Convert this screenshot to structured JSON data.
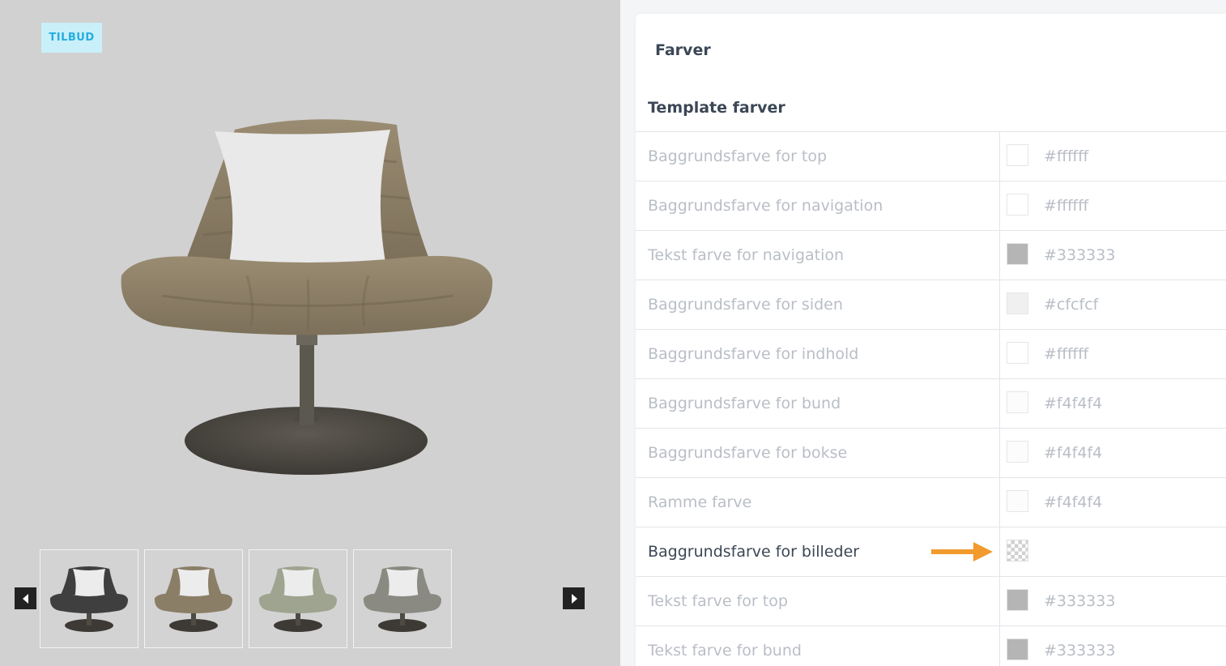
{
  "preview": {
    "badge": "TILBUD",
    "thumbnails": [
      {
        "name": "thumb-black",
        "fabric": "#3f3f3f"
      },
      {
        "name": "thumb-beige",
        "fabric": "#8b7e67"
      },
      {
        "name": "thumb-sage",
        "fabric": "#9ea48f"
      },
      {
        "name": "thumb-grey",
        "fabric": "#8a8a82"
      }
    ],
    "prev_icon": "chevron-left-icon",
    "next_icon": "chevron-right-icon"
  },
  "panel": {
    "title": "Farver",
    "section_title": "Template farver",
    "rows": [
      {
        "label": "Baggrundsfarve for top",
        "hex": "#ffffff",
        "swatch": "#ffffff"
      },
      {
        "label": "Baggrundsfarve for navigation",
        "hex": "#ffffff",
        "swatch": "#ffffff"
      },
      {
        "label": "Tekst farve for navigation",
        "hex": "#333333",
        "swatch": "#b5b5b5"
      },
      {
        "label": "Baggrundsfarve for siden",
        "hex": "#cfcfcf",
        "swatch": "#f0f0f0"
      },
      {
        "label": "Baggrundsfarve for indhold",
        "hex": "#ffffff",
        "swatch": "#ffffff"
      },
      {
        "label": "Baggrundsfarve for bund",
        "hex": "#f4f4f4",
        "swatch": "#fcfcfc"
      },
      {
        "label": "Baggrundsfarve for bokse",
        "hex": "#f4f4f4",
        "swatch": "#fcfcfc"
      },
      {
        "label": "Ramme farve",
        "hex": "#f4f4f4",
        "swatch": "#fcfcfc"
      },
      {
        "label": "Baggrundsfarve for billeder",
        "hex": "",
        "swatch": "transparent",
        "active": true
      },
      {
        "label": "Tekst farve for top",
        "hex": "#333333",
        "swatch": "#b5b5b5"
      },
      {
        "label": "Tekst farve for bund",
        "hex": "#333333",
        "swatch": "#b5b5b5"
      }
    ]
  },
  "colors": {
    "accent_arrow": "#f19a2e",
    "badge_bg": "#c9eff9",
    "badge_text": "#25aee0",
    "label_muted": "#b9bec6",
    "label_active": "#3b4756"
  }
}
